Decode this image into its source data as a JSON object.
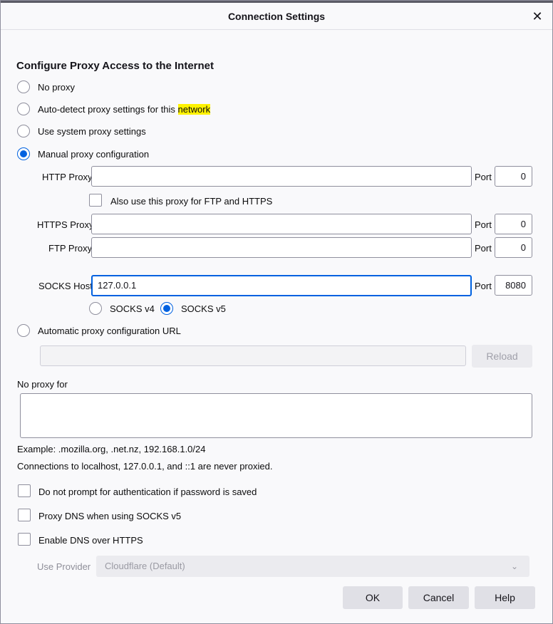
{
  "window": {
    "title": "Connection Settings",
    "close_glyph": "✕"
  },
  "heading": "Configure Proxy Access to the Internet",
  "proxy_modes": [
    {
      "label": "No proxy",
      "checked": false
    },
    {
      "label_before": "Auto-detect proxy settings for this ",
      "highlight": "network",
      "checked": false
    },
    {
      "label": "Use system proxy settings",
      "checked": false
    },
    {
      "label": "Manual proxy configuration",
      "checked": true
    }
  ],
  "manual": {
    "http_label": "HTTP Proxy",
    "http_value": "",
    "http_port": "0",
    "also_use_label": "Also use this proxy for FTP and HTTPS",
    "https_label": "HTTPS Proxy",
    "https_value": "",
    "https_port": "0",
    "ftp_label": "FTP Proxy",
    "ftp_value": "",
    "ftp_port": "0",
    "socks_label": "SOCKS Host",
    "socks_value": "127.0.0.1",
    "socks_port": "8080",
    "port_label": "Port",
    "socks_v4_label": "SOCKS v4",
    "socks_v4_checked": false,
    "socks_v5_label": "SOCKS v5",
    "socks_v5_checked": true
  },
  "auto_config": {
    "label": "Automatic proxy configuration URL",
    "value": "",
    "reload_label": "Reload",
    "checked": false
  },
  "no_proxy": {
    "label": "No proxy for",
    "value": "",
    "example": "Example: .mozilla.org, .net.nz, 192.168.1.0/24",
    "note": "Connections to localhost, 127.0.0.1, and ::1 are never proxied."
  },
  "options": [
    {
      "label": "Do not prompt for authentication if password is saved",
      "checked": false
    },
    {
      "label": "Proxy DNS when using SOCKS v5",
      "checked": false
    },
    {
      "label": "Enable DNS over HTTPS",
      "checked": false
    }
  ],
  "provider": {
    "label": "Use Provider",
    "value": "Cloudflare (Default)"
  },
  "buttons": {
    "ok": "OK",
    "cancel": "Cancel",
    "help": "Help"
  },
  "colors": {
    "accent": "#0061e0",
    "highlight": "#fff200"
  }
}
